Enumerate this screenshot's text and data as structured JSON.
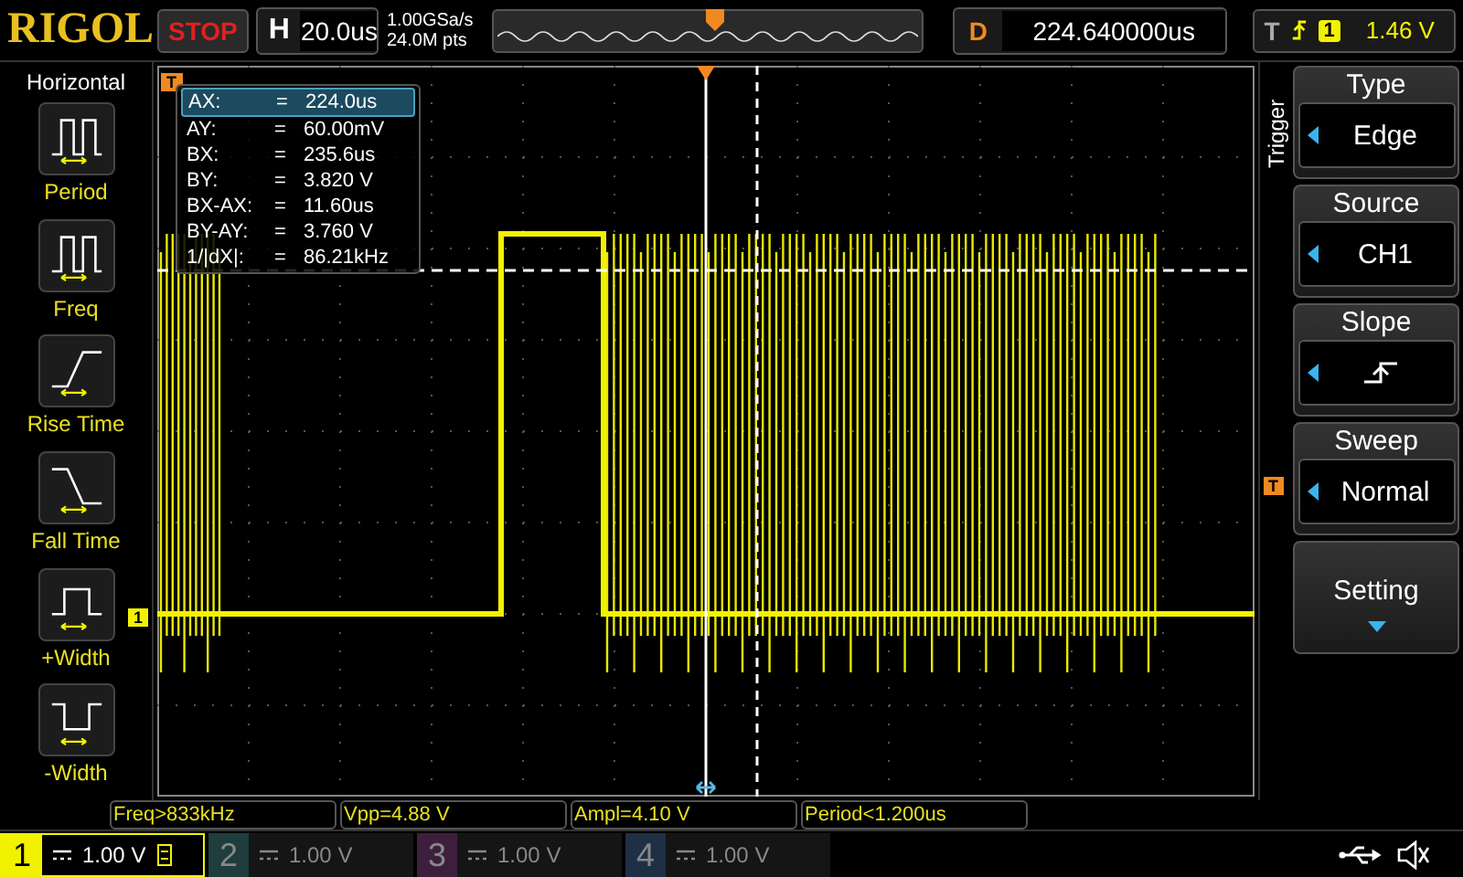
{
  "brand": "RIGOL",
  "run_state": "STOP",
  "horizontal": {
    "label": "H",
    "value": "20.0us"
  },
  "sampling": {
    "rate": "1.00GSa/s",
    "depth": "24.0M pts"
  },
  "delay": {
    "label": "D",
    "value": "224.640000us"
  },
  "trigger": {
    "label": "T",
    "source": "1",
    "level": "1.46 V"
  },
  "left_menu": {
    "title": "Horizontal",
    "items": [
      {
        "label": "Period",
        "kind": "period"
      },
      {
        "label": "Freq",
        "kind": "freq"
      },
      {
        "label": "Rise Time",
        "kind": "rise"
      },
      {
        "label": "Fall Time",
        "kind": "fall"
      },
      {
        "label": "+Width",
        "kind": "pwidth"
      },
      {
        "label": "-Width",
        "kind": "nwidth"
      }
    ]
  },
  "screen": {
    "trigger_marker": "T",
    "level_marker": "T",
    "channel_marker": "1"
  },
  "cursor_readout": [
    {
      "label": "AX:",
      "sign": "=",
      "value": "224.0us",
      "selected": true
    },
    {
      "label": "AY:",
      "sign": "=",
      "value": "60.00mV",
      "selected": false
    },
    {
      "label": "BX:",
      "sign": "=",
      "value": "235.6us",
      "selected": false
    },
    {
      "label": "BY:",
      "sign": "=",
      "value": "3.820 V",
      "selected": false
    },
    {
      "label": "BX-AX:",
      "sign": "=",
      "value": "11.60us",
      "selected": false
    },
    {
      "label": "BY-AY:",
      "sign": "=",
      "value": "3.760 V",
      "selected": false
    },
    {
      "label": "1/|dX|:",
      "sign": "=",
      "value": "86.21kHz",
      "selected": false
    }
  ],
  "right_menu": {
    "title": "Trigger",
    "items": [
      {
        "title": "Type",
        "value": "Edge",
        "kind": "select"
      },
      {
        "title": "Source",
        "value": "CH1",
        "kind": "select"
      },
      {
        "title": "Slope",
        "kind": "slope"
      },
      {
        "title": "Sweep",
        "value": "Normal",
        "kind": "select"
      },
      {
        "title": "Setting",
        "kind": "submenu"
      }
    ]
  },
  "measurements": [
    "Freq>833kHz",
    "Vpp=4.88 V",
    "Ampl=4.10 V",
    "Period<1.200us"
  ],
  "channels": [
    {
      "number": "1",
      "scale": "1.00 V",
      "on": true,
      "color": "#f2f200"
    },
    {
      "number": "2",
      "scale": "1.00 V",
      "on": false,
      "color": "#1f3d3d"
    },
    {
      "number": "3",
      "scale": "1.00 V",
      "on": false,
      "color": "#3d1f3d"
    },
    {
      "number": "4",
      "scale": "1.00 V",
      "on": false,
      "color": "#1f2f45"
    }
  ]
}
